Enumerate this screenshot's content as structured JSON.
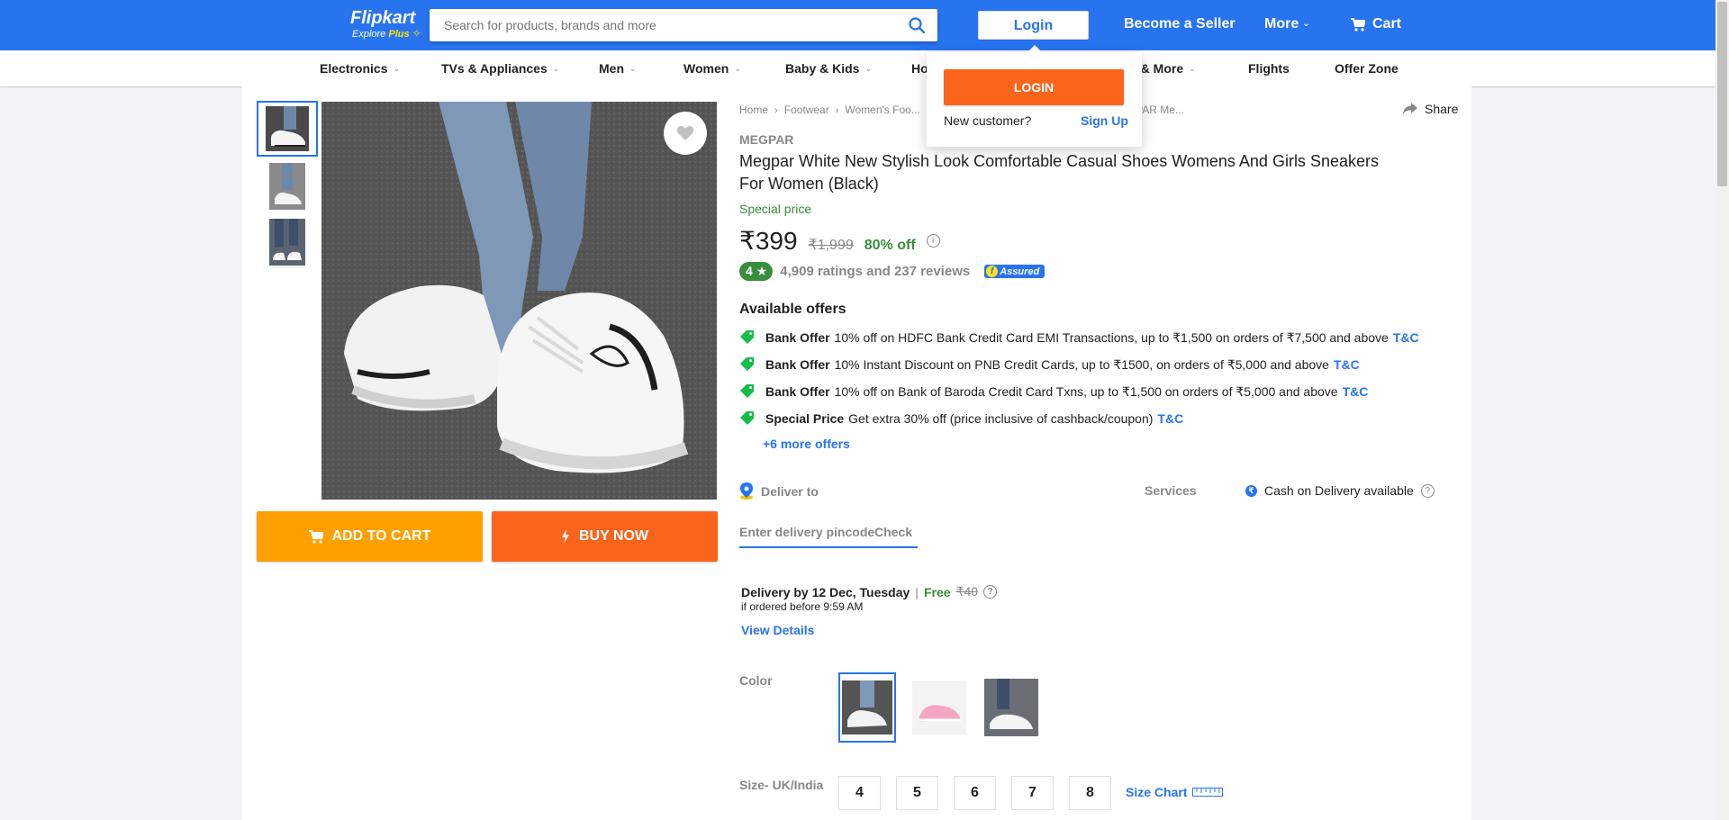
{
  "header": {
    "logo_name": "Flipkart",
    "logo_sub_explore": "Explore",
    "logo_sub_plus": "Plus",
    "search_placeholder": "Search for products, brands and more",
    "login_label": "Login",
    "seller_label": "Become a Seller",
    "more_label": "More",
    "cart_label": "Cart"
  },
  "categories": [
    {
      "label": "Electronics",
      "has_chevron": true
    },
    {
      "label": "TVs & Appliances",
      "has_chevron": true
    },
    {
      "label": "Men",
      "has_chevron": true
    },
    {
      "label": "Women",
      "has_chevron": true
    },
    {
      "label": "Baby & Kids",
      "has_chevron": true
    },
    {
      "label": "Ho",
      "has_chevron": false
    },
    {
      "label": "s & More",
      "has_chevron": true
    },
    {
      "label": "Flights",
      "has_chevron": false
    },
    {
      "label": "Offer Zone",
      "has_chevron": false
    }
  ],
  "login_dropdown": {
    "login_button": "LOGIN",
    "new_customer": "New customer?",
    "signup": "Sign Up"
  },
  "product_images": {
    "thumbnails": [
      "thumb-1",
      "thumb-2",
      "thumb-3"
    ],
    "selected_thumbnail": 0
  },
  "actions": {
    "add_to_cart": "ADD TO CART",
    "buy_now": "BUY NOW"
  },
  "breadcrumbs": [
    "Home",
    "Footwear",
    "Women's Foo...",
    "PAR Me..."
  ],
  "share_label": "Share",
  "product": {
    "brand": "MEGPAR",
    "title": "Megpar White New Stylish Look Comfortable Casual Shoes Womens And Girls Sneakers For Women  (Black)",
    "special_price_label": "Special price",
    "price": "₹399",
    "mrp": "₹1,999",
    "discount": "80% off",
    "rating": "4",
    "rating_star": "★",
    "ratings_reviews": "4,909 ratings and 237 reviews",
    "assured_label": "Assured"
  },
  "offers": {
    "heading": "Available offers",
    "items": [
      {
        "type": "Bank Offer",
        "text": "10% off on HDFC Bank Credit Card EMI Transactions, up to ₹1,500 on orders of ₹7,500 and above",
        "link": "T&C"
      },
      {
        "type": "Bank Offer",
        "text": "10% Instant Discount on PNB Credit Cards, up to ₹1500, on orders of ₹5,000 and above",
        "link": "T&C"
      },
      {
        "type": "Bank Offer",
        "text": "10% off on Bank of Baroda Credit Card Txns, up to ₹1,500 on orders of ₹5,000 and above",
        "link": "T&C"
      },
      {
        "type": "Special Price",
        "text": "Get extra 30% off (price inclusive of cashback/coupon)",
        "link": "T&C"
      }
    ],
    "more_offers": "+6 more offers"
  },
  "delivery": {
    "deliver_to_label": "Deliver to",
    "pincode_placeholder": "Enter delivery pincode",
    "check_label": "Check",
    "delivery_by": "Delivery by 12 Dec, Tuesday",
    "pipe": "|",
    "free": "Free",
    "fee_mrp": "₹40",
    "ordered_before": "if ordered before 9:59 AM",
    "view_details": "View Details"
  },
  "services": {
    "label": "Services",
    "cod": "Cash on Delivery available"
  },
  "color": {
    "label": "Color",
    "swatches": [
      "white-black",
      "pink",
      "white-grey"
    ],
    "selected": 0
  },
  "size": {
    "label": "Size- UK/India",
    "options": [
      "4",
      "5",
      "6",
      "7",
      "8"
    ],
    "size_chart": "Size Chart"
  },
  "colors": {
    "brand_blue": "#2874f0",
    "cart_orange": "#ff9f00",
    "buy_orange": "#fb641b",
    "green": "#388e3c"
  }
}
